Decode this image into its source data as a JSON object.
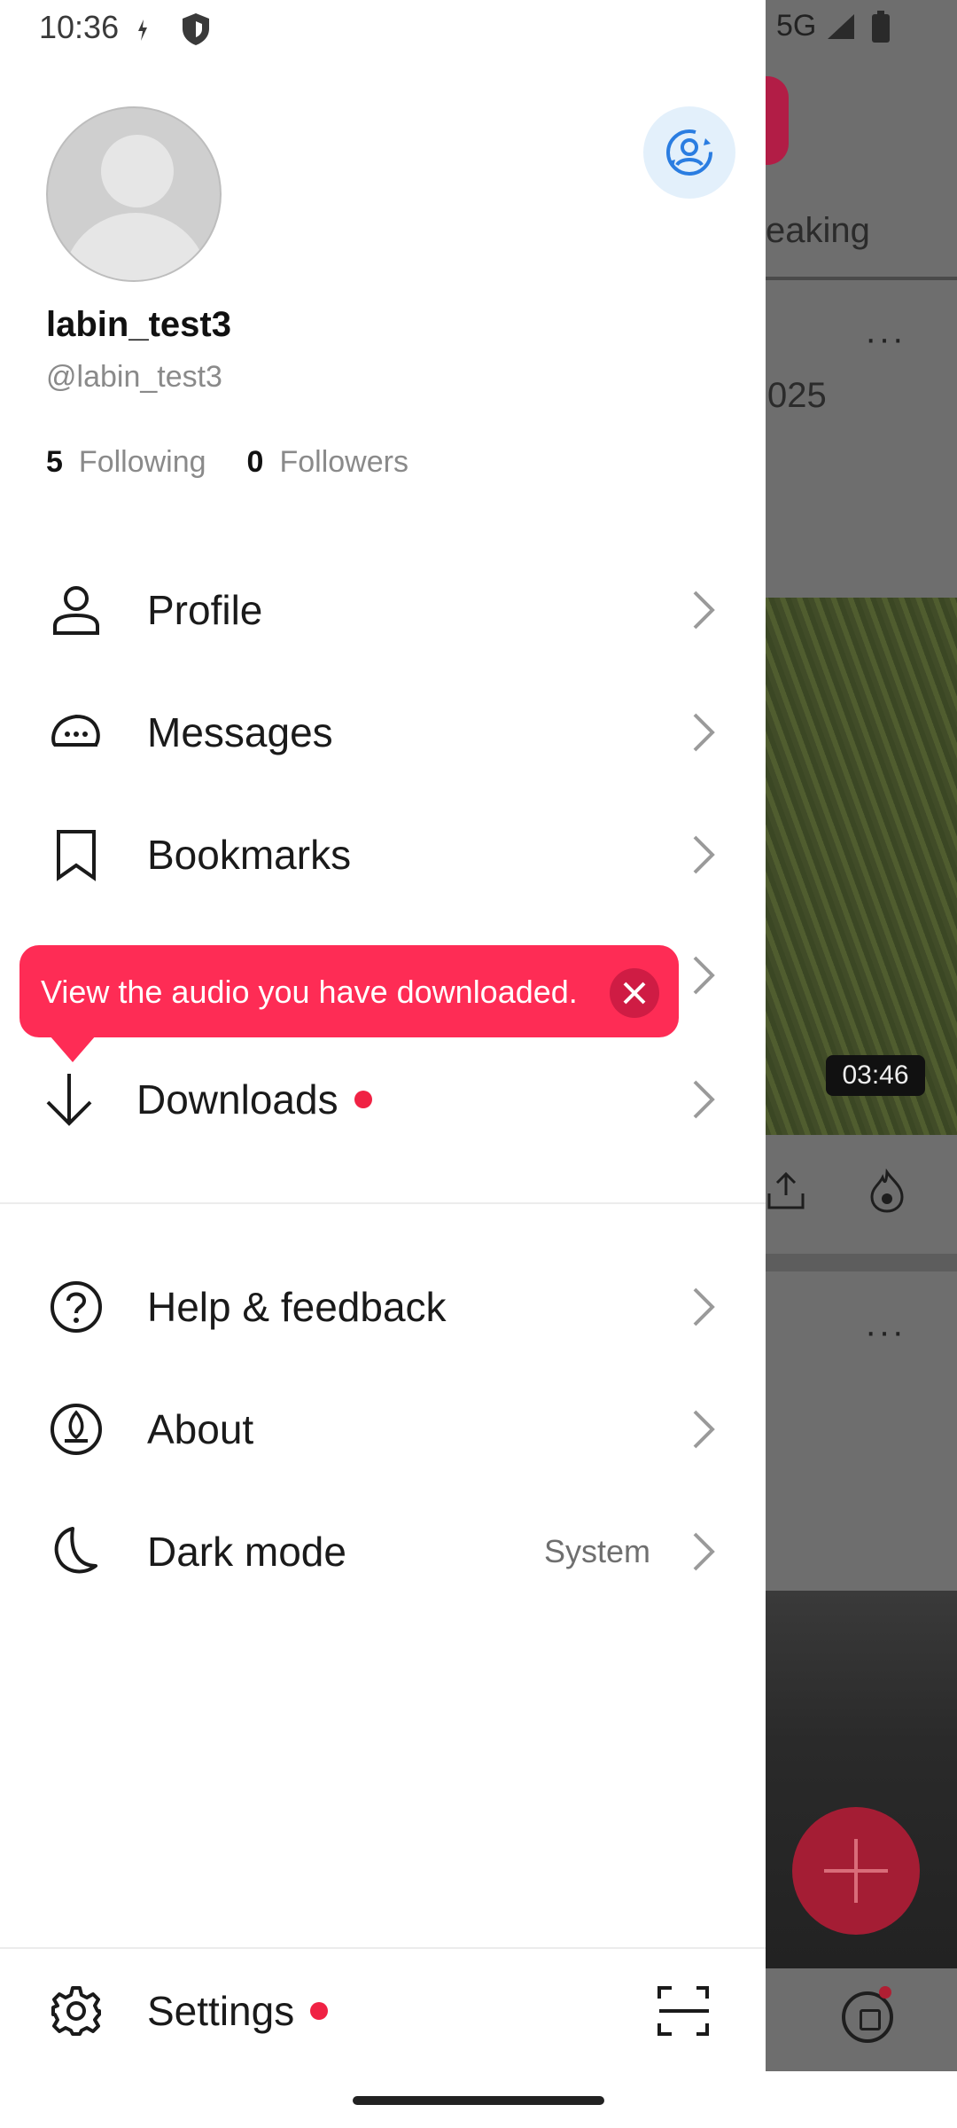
{
  "status_bar": {
    "time": "10:36",
    "network": "5G"
  },
  "background": {
    "tab_fragment": "eaking",
    "date_fragment": "025",
    "video_duration": "03:46",
    "more_label": "···"
  },
  "profile": {
    "username": "labin_test3",
    "handle": "@labin_test3",
    "following_count": "5",
    "following_label": "Following",
    "followers_count": "0",
    "followers_label": "Followers"
  },
  "menu": {
    "profile": "Profile",
    "messages": "Messages",
    "bookmarks": "Bookmarks",
    "downloads": "Downloads",
    "help": "Help & feedback",
    "about": "About",
    "dark_mode": "Dark mode",
    "dark_mode_value": "System",
    "settings": "Settings"
  },
  "tooltip": {
    "text": "View the audio you have downloaded."
  },
  "colors": {
    "accent": "#fe2c55",
    "badge": "#f02244",
    "switch_icon": "#2a7de1"
  }
}
